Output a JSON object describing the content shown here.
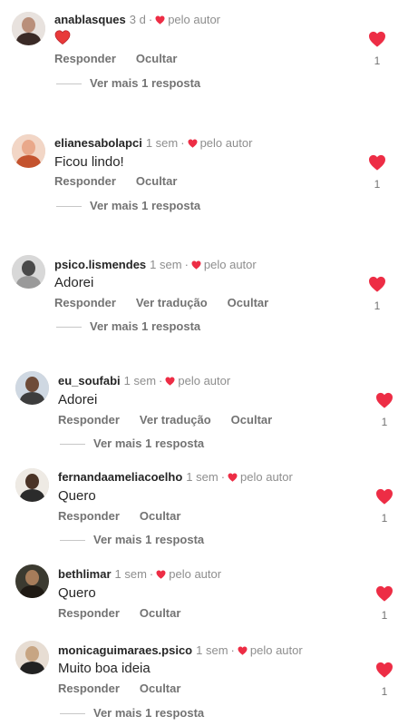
{
  "comments": [
    {
      "username": "anablasques",
      "time": "3 d",
      "author_like": "pelo autor",
      "text": "",
      "emoji": "heart-emoji",
      "actions": [
        "Responder",
        "Ocultar"
      ],
      "replies_label": "Ver mais 1 resposta",
      "likes": "1",
      "avatar_colors": [
        "#e8e2de",
        "#3a2a26",
        "#b98f7a"
      ]
    },
    {
      "username": "elianesabolapci",
      "time": "1 sem",
      "author_like": "pelo autor",
      "text": "Ficou lindo!",
      "actions": [
        "Responder",
        "Ocultar"
      ],
      "replies_label": "Ver mais 1 resposta",
      "likes": "1",
      "avatar_colors": [
        "#f2d6c6",
        "#c4532e",
        "#e9a88a"
      ]
    },
    {
      "username": "psico.lismendes",
      "time": "1 sem",
      "author_like": "pelo autor",
      "text": "Adorei",
      "actions": [
        "Responder",
        "Ver tradução",
        "Ocultar"
      ],
      "replies_label": "Ver mais 1 resposta",
      "likes": "1",
      "avatar_colors": [
        "#d8d8d8",
        "#9a9a9a",
        "#4a4a4a"
      ]
    },
    {
      "username": "eu_soufabi",
      "time": "1 sem",
      "author_like": "pelo autor",
      "text": "Adorei",
      "actions": [
        "Responder",
        "Ver tradução",
        "Ocultar"
      ],
      "replies_label": "Ver mais 1 resposta",
      "likes": "1",
      "avatar_colors": [
        "#cfd8e2",
        "#6e4b38",
        "#3d3d3d"
      ]
    },
    {
      "username": "fernandaameliacoelho",
      "time": "1 sem",
      "author_like": "pelo autor",
      "text": "Quero",
      "actions": [
        "Responder",
        "Ocultar"
      ],
      "replies_label": "Ver mais 1 resposta",
      "likes": "1",
      "avatar_colors": [
        "#eeeae4",
        "#4a3326",
        "#2b2b2b"
      ]
    },
    {
      "username": "bethlimar",
      "time": "1 sem",
      "author_like": "pelo autor",
      "text": "Quero",
      "actions": [
        "Responder",
        "Ocultar"
      ],
      "replies_label": "",
      "likes": "1",
      "avatar_colors": [
        "#3b3a30",
        "#1f1a14",
        "#a67c5a"
      ]
    },
    {
      "username": "monicaguimaraes.psico",
      "time": "1 sem",
      "author_like": "pelo autor",
      "text": "Muito boa ideia",
      "actions": [
        "Responder",
        "Ocultar"
      ],
      "replies_label": "Ver mais 1 resposta",
      "likes": "1",
      "avatar_colors": [
        "#e7ddd3",
        "#c7a583",
        "#222222"
      ]
    }
  ],
  "colors": {
    "heart": "#ed2d45",
    "muted": "#737373",
    "divider": "#c7c7c7"
  }
}
